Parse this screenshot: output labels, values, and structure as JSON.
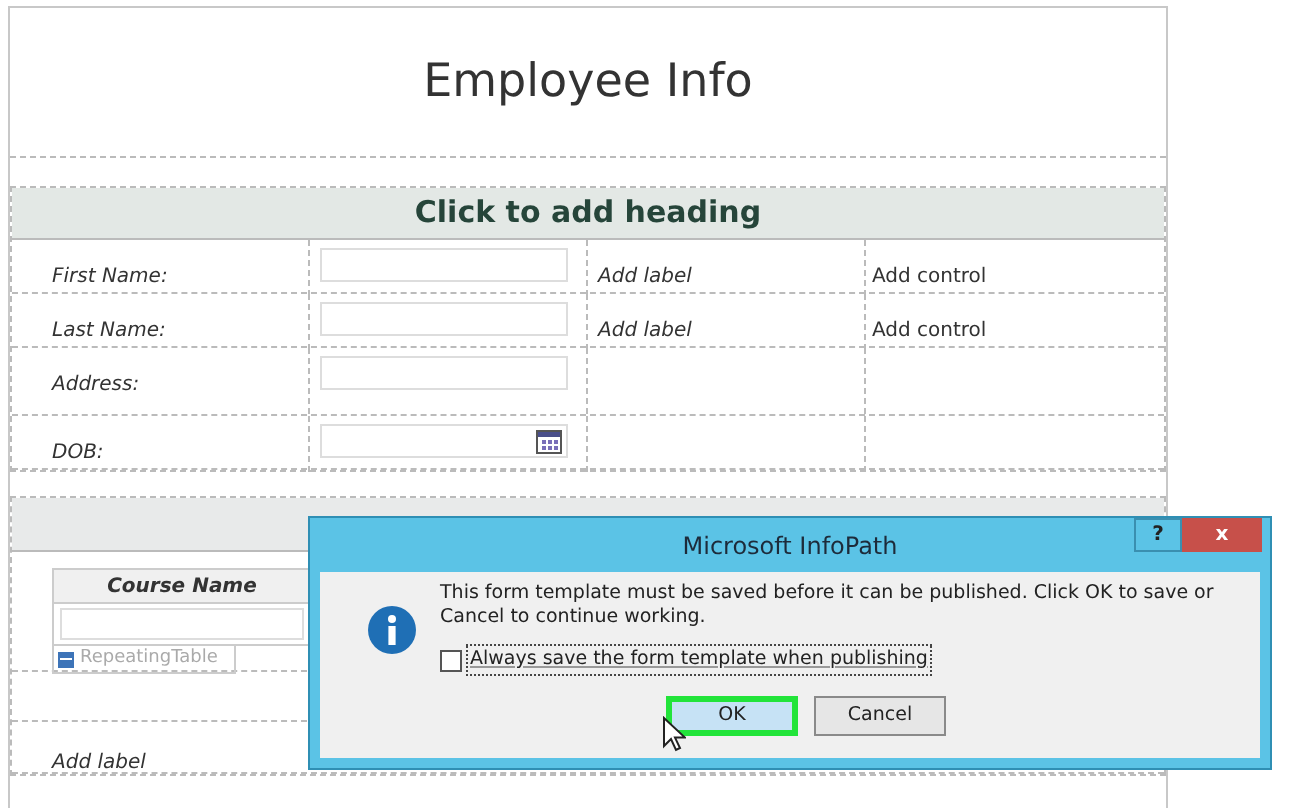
{
  "title": "Employee Info",
  "heading": "Click to add heading",
  "rows": [
    {
      "label": "First Name:",
      "field": {
        "kind": "text"
      },
      "extra_label": "Add label",
      "extra_control": "Add control"
    },
    {
      "label": "Last Name:",
      "field": {
        "kind": "text"
      },
      "extra_label": "Add label",
      "extra_control": "Add control"
    },
    {
      "label": "Address:",
      "field": {
        "kind": "text"
      }
    },
    {
      "label": "DOB:",
      "field": {
        "kind": "date"
      }
    }
  ],
  "repeating_table": {
    "columns": [
      "Course Name"
    ],
    "tag": "RepeatingTable"
  },
  "footer_label": "Add label",
  "dialog": {
    "title": "Microsoft InfoPath",
    "help": "?",
    "close": "x",
    "message": "This form template must be saved before it can be published. Click OK to save or Cancel to continue working.",
    "checkbox": {
      "label": "Always save the form template when publishing",
      "checked": false
    },
    "buttons": [
      {
        "label": "OK",
        "selected": true
      },
      {
        "label": "Cancel",
        "selected": false
      }
    ]
  }
}
